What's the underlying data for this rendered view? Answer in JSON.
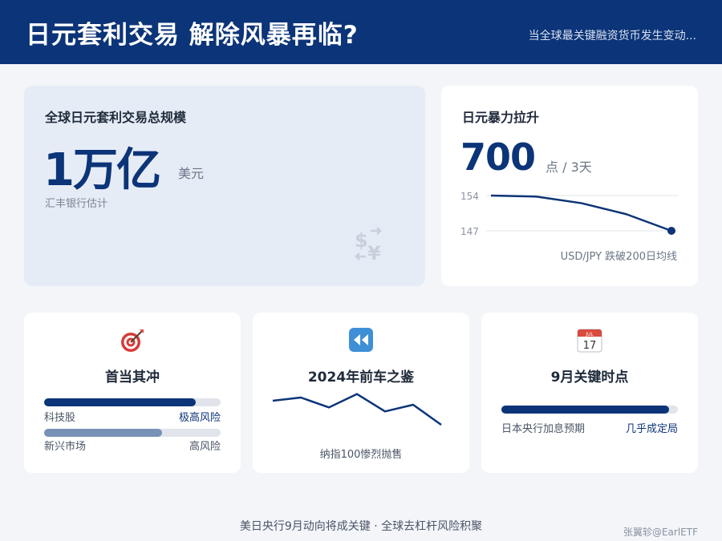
{
  "header": {
    "title": "日元套利交易 解除风暴再临?",
    "subtitle": "当全球最关键融资货币发生变动..."
  },
  "carry_card": {
    "title": "全球日元套利交易总规模",
    "value": "1万亿",
    "unit": "美元",
    "note": "汇丰银行估计",
    "icon": "currency-exchange-icon"
  },
  "yen_card": {
    "title": "日元暴力拉升",
    "value": "700",
    "unit": "点 / 3天",
    "note": "USD/JPY 跌破200日均线",
    "chart": {
      "y_labels": [
        "154",
        "147"
      ],
      "points": [
        154,
        153.8,
        152.5,
        150.3,
        147
      ]
    }
  },
  "impact_card": {
    "icon": "target-icon",
    "title": "首当其冲",
    "rows": [
      {
        "label": "科技股",
        "level": "极高风险",
        "fill": 0.86,
        "color": "#0c3478"
      },
      {
        "label": "新兴市场",
        "level": "高风险",
        "fill": 0.67,
        "color": "#7891b6"
      }
    ]
  },
  "history_card": {
    "icon": "rewind-icon",
    "title": "2024年前车之鉴",
    "note": "纳指100惨烈抛售",
    "line": [
      0.7,
      0.82,
      0.45,
      0.95,
      0.3,
      0.55,
      -0.2
    ]
  },
  "september_card": {
    "icon": "calendar-icon",
    "calendar_month": "JUL",
    "calendar_day": "17",
    "title": "9月关键时点",
    "row": {
      "label": "日本央行加息预期",
      "level": "几乎成定局",
      "fill": 0.95,
      "color": "#0c3478"
    }
  },
  "footer": {
    "text": "美日央行9月动向将成关键 · 全球去杠杆风险积聚",
    "credit": "张翼轸@EarlETF"
  }
}
